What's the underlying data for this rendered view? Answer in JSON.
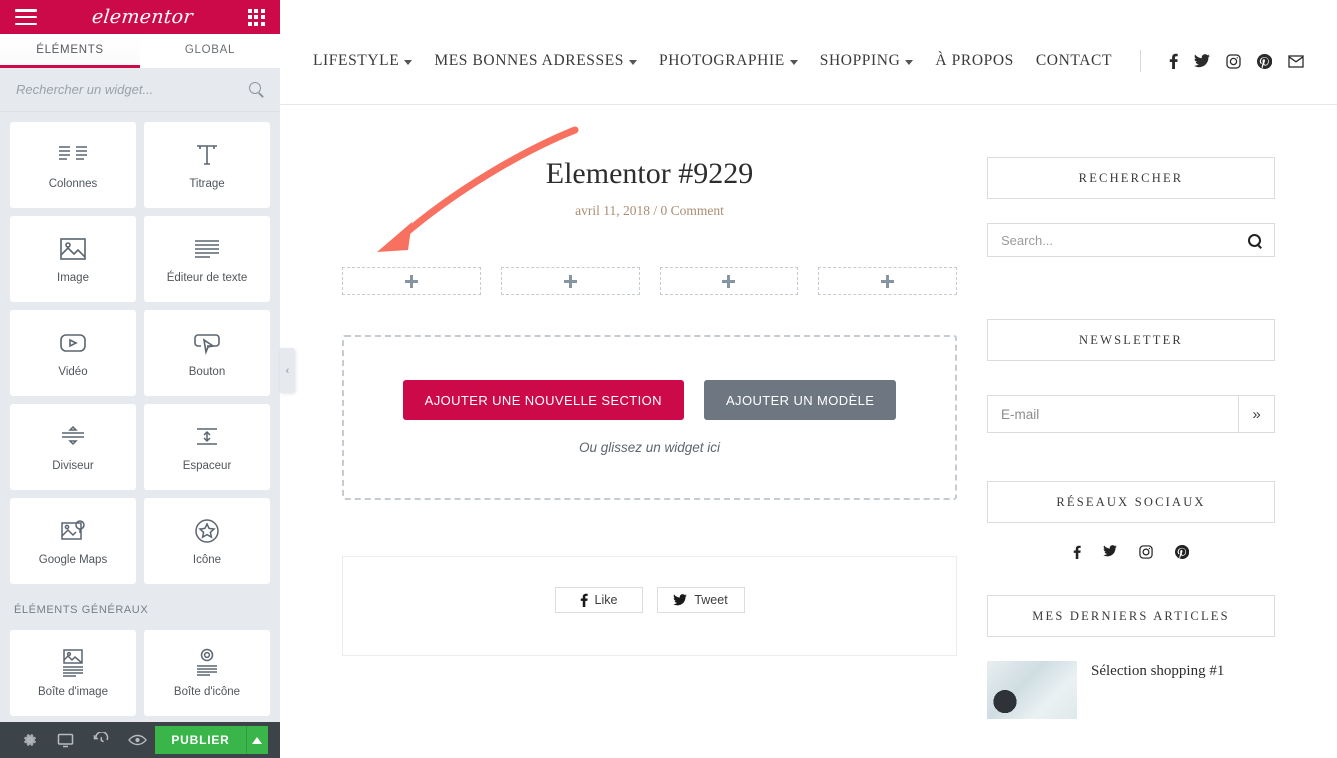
{
  "editor": {
    "brand": "elementor",
    "menu_icon": "hamburger-icon",
    "apps_icon": "grid-apps-icon",
    "tabs": [
      {
        "id": "elements",
        "label": "ÉLÉMENTS",
        "active": true
      },
      {
        "id": "global",
        "label": "GLOBAL",
        "active": false
      }
    ],
    "search": {
      "placeholder": "Rechercher un widget...",
      "value": ""
    },
    "widget_sections": [
      {
        "label": "",
        "widgets": [
          {
            "name": "Colonnes",
            "icon": "columns-icon"
          },
          {
            "name": "Titrage",
            "icon": "heading-icon"
          },
          {
            "name": "Image",
            "icon": "image-icon"
          },
          {
            "name": "Éditeur de texte",
            "icon": "text-editor-icon"
          },
          {
            "name": "Vidéo",
            "icon": "video-icon"
          },
          {
            "name": "Bouton",
            "icon": "button-icon"
          },
          {
            "name": "Diviseur",
            "icon": "divider-icon"
          },
          {
            "name": "Espaceur",
            "icon": "spacer-icon"
          },
          {
            "name": "Google Maps",
            "icon": "map-icon"
          },
          {
            "name": "Icône",
            "icon": "star-icon"
          }
        ]
      },
      {
        "label": "ÉLÉMENTS GÉNÉRAUX",
        "widgets": [
          {
            "name": "Boîte d'image",
            "icon": "image-box-icon"
          },
          {
            "name": "Boîte d'icône",
            "icon": "icon-box-icon"
          }
        ]
      }
    ],
    "footer": {
      "settings_label": "gear-icon",
      "responsive_label": "desktop-icon",
      "history_label": "history-icon",
      "preview_label": "eye-icon",
      "publish_label": "PUBLIER",
      "publish_caret": "▲"
    },
    "collapse_handle": "‹",
    "colors": {
      "brand": "#cc0a4a",
      "publish": "#39b54a",
      "panel_bg": "#e6eaee",
      "footer_bg": "#3d4449",
      "annotation_arrow": "#f8705f"
    }
  },
  "site": {
    "nav": [
      {
        "label": "LIFESTYLE",
        "has_submenu": true
      },
      {
        "label": "MES BONNES ADRESSES",
        "has_submenu": true
      },
      {
        "label": "PHOTOGRAPHIE",
        "has_submenu": true
      },
      {
        "label": "SHOPPING",
        "has_submenu": true
      },
      {
        "label": "À PROPOS",
        "has_submenu": false
      },
      {
        "label": "CONTACT",
        "has_submenu": false
      }
    ],
    "nav_social": [
      "facebook-icon",
      "twitter-icon",
      "instagram-icon",
      "pinterest-icon",
      "email-icon"
    ],
    "post": {
      "title": "Elementor #9229",
      "date": "avril 11, 2018",
      "meta_separator": "/",
      "comments": "0 Comment"
    },
    "empty_columns": [
      {
        "add_icon": "plus-icon"
      },
      {
        "add_icon": "plus-icon"
      },
      {
        "add_icon": "plus-icon"
      },
      {
        "add_icon": "plus-icon"
      }
    ],
    "add_area": {
      "new_section_label": "AJOUTER UNE NOUVELLE SECTION",
      "template_label": "AJOUTER UN MODÈLE",
      "drag_hint": "Ou glissez un widget ici"
    },
    "share": [
      {
        "label": "Like",
        "icon": "facebook-icon"
      },
      {
        "label": "Tweet",
        "icon": "twitter-icon"
      }
    ],
    "sidebar": {
      "search_widget": {
        "title": "RECHERCHER",
        "placeholder": "Search...",
        "value": "",
        "icon": "search-icon"
      },
      "newsletter_widget": {
        "title": "NEWSLETTER",
        "placeholder": "E-mail",
        "value": "",
        "submit": "»"
      },
      "social_widget": {
        "title": "RÉSEAUX SOCIAUX",
        "icons": [
          "facebook-icon",
          "twitter-icon",
          "instagram-icon",
          "pinterest-icon"
        ]
      },
      "articles_widget": {
        "title": "MES DERNIERS ARTICLES",
        "items": [
          {
            "title": "Sélection shopping #1"
          }
        ]
      }
    }
  }
}
